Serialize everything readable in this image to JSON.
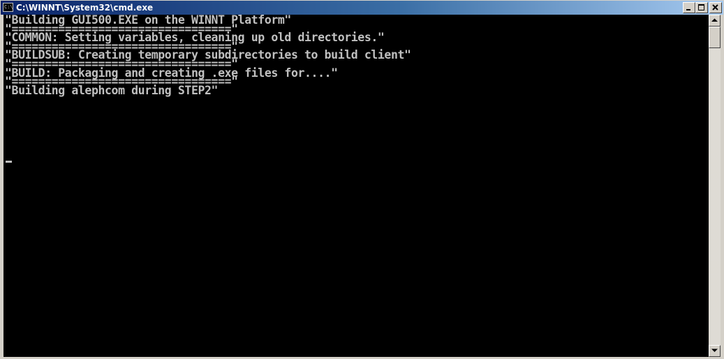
{
  "window": {
    "title": "C:\\WINNT\\System32\\cmd.exe",
    "app_icon_text": "C:\\",
    "title_gradient_start": "#0a246a",
    "title_gradient_end": "#a6caf0"
  },
  "caption_buttons": {
    "minimize": "minimize-icon",
    "maximize": "maximize-icon",
    "close": "close-icon"
  },
  "console": {
    "background": "#000000",
    "text_color": "#c0c0c0",
    "lines": [
      "\"Building GUI500.EXE on the WINNT Platform\"",
      "\"=================================\"",
      "\"COMMON: Setting variables, cleaning up old directories.\"",
      "\"=================================\"",
      "\"BUILDSUB: Creating temporary subdirectories to build client\"",
      "\"=================================\"",
      "\"BUILD: Packaging and creating .exe files for....\"",
      "\"=================================\"",
      "\"Building alephcom during STEP2\""
    ]
  },
  "scrollbar": {
    "up_icon": "arrow-up-icon",
    "down_icon": "arrow-down-icon",
    "position_fraction": 0.0
  }
}
